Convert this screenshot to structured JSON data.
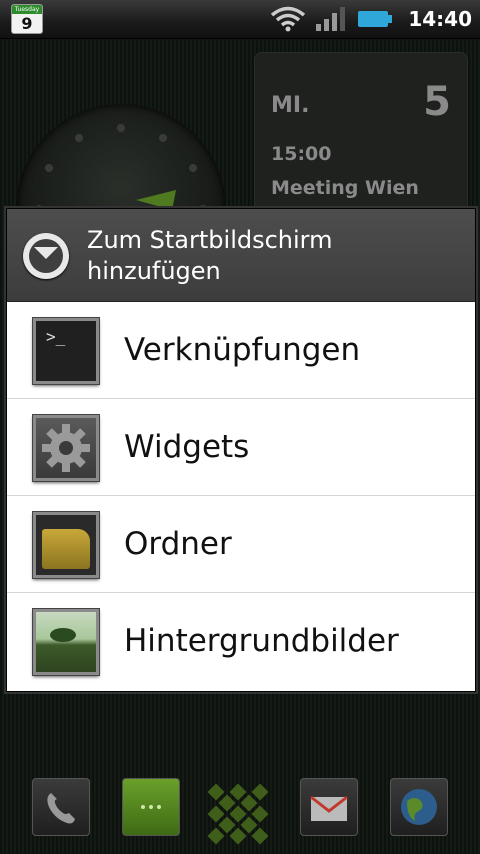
{
  "status_bar": {
    "calendar_icon": {
      "weekday": "Tuesday",
      "day": "9"
    },
    "time": "14:40",
    "icons": [
      "wifi-icon",
      "signal-icon",
      "battery-icon"
    ],
    "battery_color": "#2fa7d8"
  },
  "home": {
    "calendar_widget": {
      "day_abbr": "MI.",
      "date": "5",
      "event_time": "15:00",
      "event_title": "Meeting Wien"
    },
    "dock": [
      "phone-icon",
      "messaging-icon",
      "app-drawer-icon",
      "gmail-icon",
      "browser-icon"
    ]
  },
  "dialog": {
    "title": "Zum Startbildschirm hinzufügen",
    "items": [
      {
        "label": "Verknüpfungen",
        "icon": "shortcut-terminal-icon"
      },
      {
        "label": "Widgets",
        "icon": "widget-gear-icon"
      },
      {
        "label": "Ordner",
        "icon": "folder-icon"
      },
      {
        "label": "Hintergrundbilder",
        "icon": "wallpaper-icon"
      }
    ]
  },
  "colors": {
    "accent_green": "#2e8b2e",
    "dialog_header": "#444444",
    "list_background": "#ffffff"
  }
}
